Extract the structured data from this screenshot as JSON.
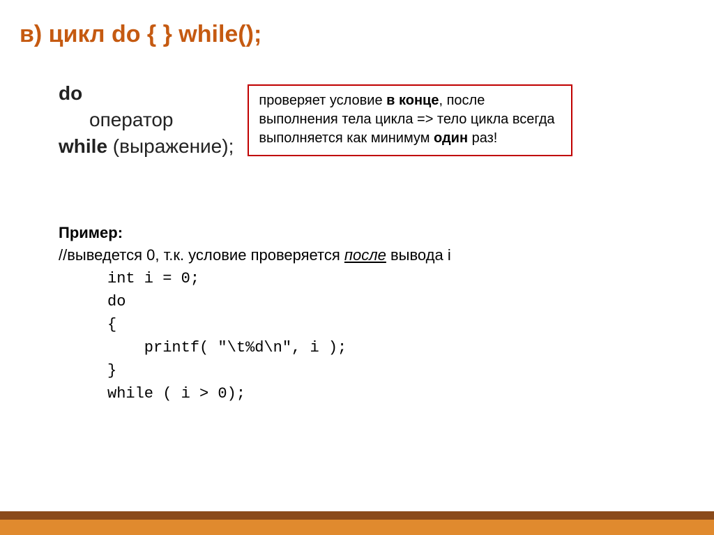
{
  "title": "в) цикл do {  } while();",
  "syntax": {
    "do": "do",
    "operator": "оператор",
    "while": "while",
    "expression": "(выражение);"
  },
  "callout": {
    "part1": "проверяет условие ",
    "bold1": "в конце",
    "part2": ", после выполнения тела цикла => тело цикла всегда выполняется как минимум ",
    "bold2": "один",
    "part3": " раз!"
  },
  "example": {
    "label": "Пример:",
    "desc_pre": "//выведется 0, т.к. условие проверяется ",
    "desc_after": "после",
    "desc_post": " вывода i",
    "code": "int i = 0;\ndo\n{\n    рrintf( \"\\t%d\\n\", i );\n}\nwhile ( i > 0);"
  }
}
